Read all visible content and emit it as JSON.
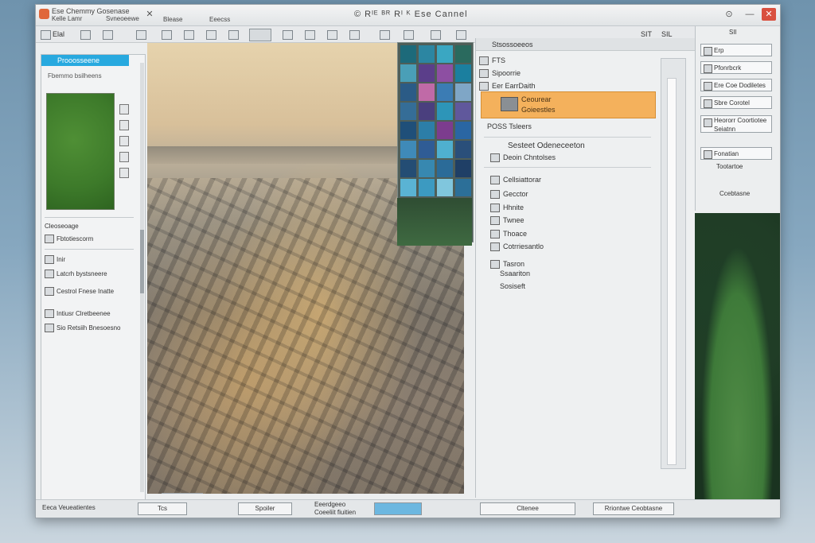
{
  "window": {
    "title_line1": "Ese Chemmy Gosenase",
    "title_line2": "Kelle Lamr",
    "title_menu1": "Svneoeewe",
    "title_menu2": "Blease",
    "title_menu3": "Eeecss",
    "title_center": "© Rᴵᴱ ᴮᴿ Rᴵ ᴷ  Ese Cannel",
    "controls": {
      "help": "⊙",
      "minimize": "—",
      "close": "✕"
    }
  },
  "toolbar": {
    "item1": "Elal",
    "item2": "SIT",
    "item3": "SIL"
  },
  "left_panel": {
    "tab_label": "Prooosseene",
    "subtitle": "Fbemmo bsilheens",
    "section_header": "Cleoseoage",
    "rows": [
      "Fbtotiescorm",
      "Inir",
      "Latcrh bystsneere",
      "Cestrol Fnese Inatte",
      "Intiusr Clretbeenee",
      "Sio Retsiih Bnesoesno"
    ],
    "bottom_label": "Eeca Veueatientes"
  },
  "middle_panel": {
    "header": "Stsossoeeos",
    "rows": [
      "FTS",
      "Sipoorrie",
      "Eer EarrDaith"
    ],
    "selected_line1": "Ceourear",
    "selected_line2": "Goieestles",
    "section_label": "POSS Tsleers",
    "sub_header": "Sesteet Odeneceeton",
    "sub_rows": [
      "Deoin Chntolses",
      "Cellsiattorar",
      "Gecctor",
      "Hhnite",
      "Twnee",
      "Thoace",
      "Cotrriesantlo",
      "Tasron",
      "Ssaariton",
      "Sosiseft"
    ]
  },
  "right_panel": {
    "top": "SIl",
    "items": [
      "Erp",
      "Pfonrbcrk",
      "Ere Coe Dodiletes",
      "Sbre Corotel",
      "Heororr Coortiotee Seiatnn",
      "Fonatian"
    ],
    "note": "Tootartoe",
    "footer": "Ccebtasne"
  },
  "statusbar": {
    "left": "Eeca Veueatientes",
    "box1": "Tcs",
    "box2": "Spoiler",
    "mid_line1": "Eeerdgeeo",
    "mid_line2": "Coeeliit fiuitien",
    "right_label": "Cltenee",
    "right_box": "Rriontwe Ceobtasne"
  },
  "colors": {
    "accent_tab": "#28a9df",
    "selected_row": "#f4b15c",
    "close_button": "#d9503f"
  }
}
